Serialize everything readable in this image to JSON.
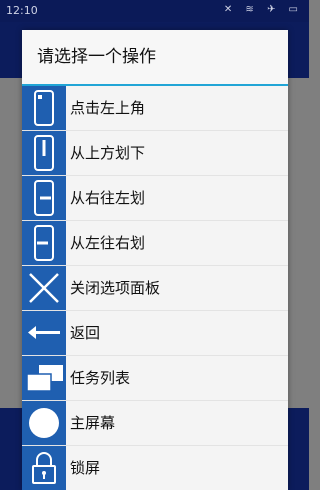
{
  "status_bar": {
    "time": "12:10",
    "icons_text": "✕ ≋ ✈ ▭"
  },
  "dialog": {
    "title": "请选择一个操作",
    "items": [
      {
        "label": "点击左上角",
        "icon": "phone-tap-corner-icon"
      },
      {
        "label": "从上方划下",
        "icon": "phone-swipe-down-icon"
      },
      {
        "label": "从右往左划",
        "icon": "phone-swipe-left-icon"
      },
      {
        "label": "从左往右划",
        "icon": "phone-swipe-right-icon"
      },
      {
        "label": "关闭选项面板",
        "icon": "close-icon"
      },
      {
        "label": "返回",
        "icon": "back-arrow-icon"
      },
      {
        "label": "任务列表",
        "icon": "recent-tasks-icon"
      },
      {
        "label": "主屏幕",
        "icon": "home-circle-icon"
      },
      {
        "label": "锁屏",
        "icon": "lock-icon"
      }
    ]
  },
  "colors": {
    "accent": "#21a5d6",
    "icon_bg": "#1f5fb0",
    "app_bar": "#0c1c5c"
  }
}
